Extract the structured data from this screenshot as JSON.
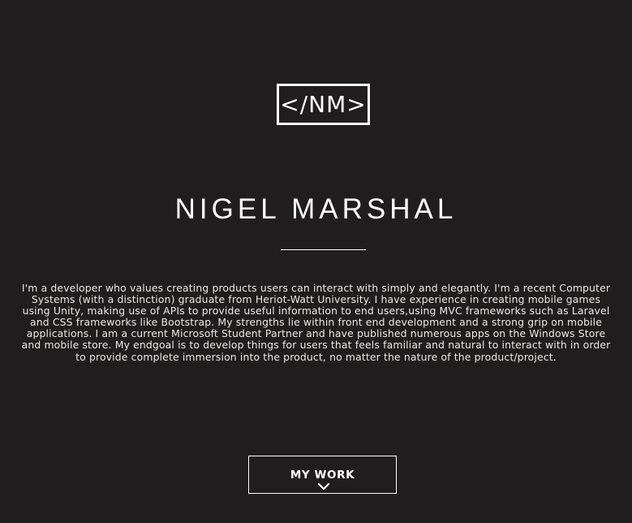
{
  "hero": {
    "logo_text": "</NM>",
    "name": "NIGEL MARSHAL",
    "bio": "I'm a developer who values creating products users can interact with simply and elegantly. I'm a recent Computer Systems (with a distinction) graduate from Heriot-Watt University. I have experience in creating mobile games using Unity, making use of APIs to provide useful information to end users,using MVC frameworks such as Laravel and CSS frameworks like Bootstrap. My strengths lie within front end development and a strong grip on mobile applications. I am a current Microsoft Student Partner and have published numerous apps on the Windows Store and mobile store. My endgoal is to develop things for users that feels familiar and natural to interact with in order to provide complete immersion into the product, no matter the nature of the product/project.",
    "button_label": "MY WORK",
    "button_icon": "chevron-down-icon"
  },
  "colors": {
    "background": "#1f1d1d",
    "foreground": "#ffffff"
  }
}
